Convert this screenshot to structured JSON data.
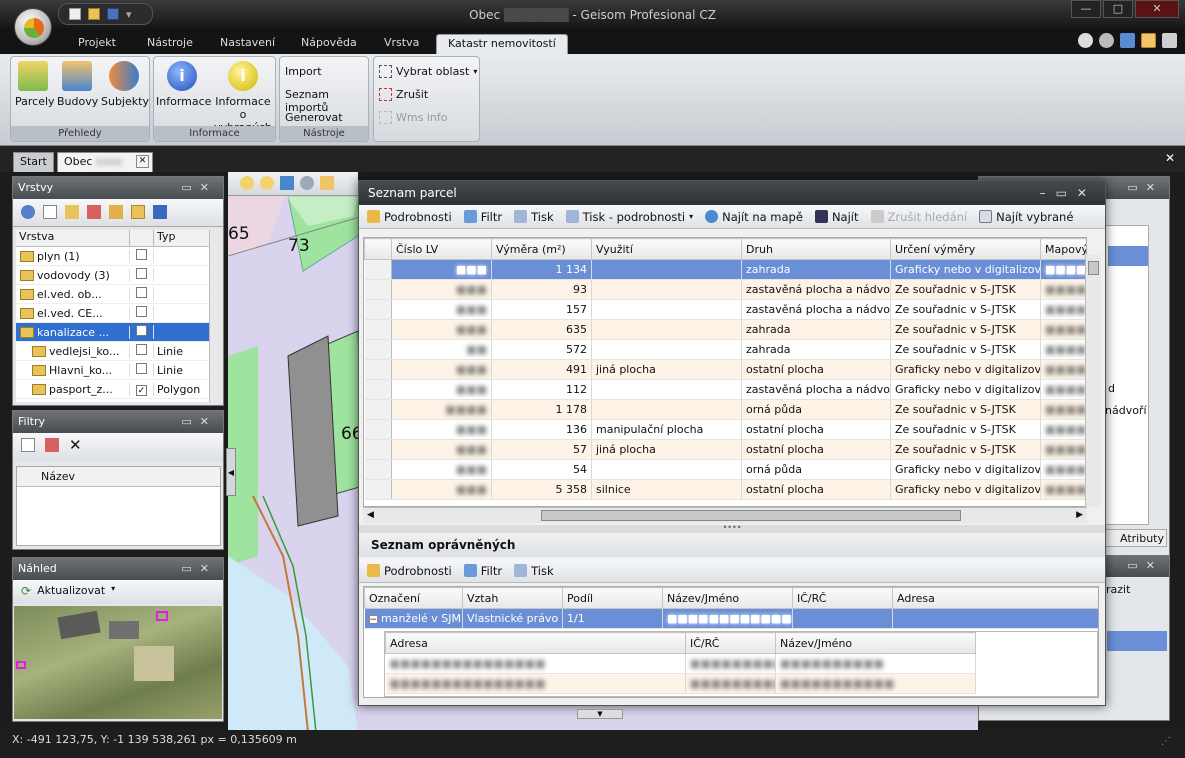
{
  "window": {
    "title": "Obec ■■■■ - Geisom Profesional CZ",
    "title_prefix": "Obec",
    "title_suffix": "- Geisom Profesional CZ"
  },
  "ribbon_tabs": [
    "Projekt",
    "Nástroje",
    "Nastavení",
    "Nápověda",
    "Vrstva",
    "Katastr nemovitostí"
  ],
  "ribbon": {
    "prehledy": {
      "label": "Přehledy",
      "buttons": [
        "Parcely",
        "Budovy",
        "Subjekty"
      ]
    },
    "informace": {
      "label": "Informace",
      "buttons": [
        "Informace",
        "Informace o vybraných"
      ]
    },
    "nastroje": {
      "label": "Nástroje",
      "buttons": [
        "Import",
        "Seznam importů",
        "Generovat mapu"
      ]
    },
    "vyber": {
      "buttons": [
        "Vybrat oblast",
        "Zrušit",
        "Wms info"
      ]
    }
  },
  "doc_tabs": [
    "Start",
    "Obec"
  ],
  "vrstvy": {
    "title": "Vrstvy",
    "columns": [
      "Vrstva",
      "Typ"
    ],
    "rows": [
      {
        "name": "plyn (1)",
        "type": ""
      },
      {
        "name": "vodovody (3)",
        "type": ""
      },
      {
        "name": "el.ved. ob...",
        "type": ""
      },
      {
        "name": "el.ved. CE...",
        "type": ""
      },
      {
        "name": "kanalizace ...",
        "type": ""
      },
      {
        "name": "vedlejsi_ko...",
        "type": "Linie"
      },
      {
        "name": "Hlavni_ko...",
        "type": "Linie"
      },
      {
        "name": "pasport_z...",
        "type": "Polygon"
      }
    ]
  },
  "filtry": {
    "title": "Filtry",
    "columns": [
      "Název"
    ]
  },
  "nahled": {
    "title": "Náhled",
    "refresh": "Aktualizovat"
  },
  "map": {
    "labels": [
      "65",
      "73",
      "66"
    ]
  },
  "status": {
    "coords": "X: -491 123,75, Y: -1 139 538,26",
    "scale": "1 px = 0,135609 m"
  },
  "seznam_parcel": {
    "title": "Seznam parcel",
    "toolbar": [
      "Podrobnosti",
      "Filtr",
      "Tisk",
      "Tisk - podrobnosti",
      "Najít na mapě",
      "Najít",
      "Zrušit hledání",
      "Najít vybrané"
    ],
    "columns": [
      "Číslo LV",
      "Výměra (m²)",
      "Využití",
      "Druh",
      "Určení výměry",
      "Mapový"
    ],
    "rows": [
      {
        "lv": "■■■",
        "vymera": "1 134",
        "vyuziti": "",
        "druh": "zahrada",
        "urceni": "Graficky nebo v digitalizova...",
        "map": "■■■■■■■"
      },
      {
        "lv": "■■■",
        "vymera": "93",
        "vyuziti": "",
        "druh": "zastavěná plocha a nádvoří",
        "urceni": "Ze souřadnic v S-JTSK",
        "map": "■■■■"
      },
      {
        "lv": "■■■",
        "vymera": "157",
        "vyuziti": "",
        "druh": "zastavěná plocha a nádvoří",
        "urceni": "Ze souřadnic v S-JTSK",
        "map": "■■■■"
      },
      {
        "lv": "■■■",
        "vymera": "635",
        "vyuziti": "",
        "druh": "zahrada",
        "urceni": "Ze souřadnic v S-JTSK",
        "map": "■■■■"
      },
      {
        "lv": "■■",
        "vymera": "572",
        "vyuziti": "",
        "druh": "zahrada",
        "urceni": "Ze souřadnic v S-JTSK",
        "map": "■■■■"
      },
      {
        "lv": "■■■",
        "vymera": "491",
        "vyuziti": "jiná plocha",
        "druh": "ostatní plocha",
        "urceni": "Graficky nebo v digitalizova...",
        "map": "■■■■"
      },
      {
        "lv": "■■■",
        "vymera": "112",
        "vyuziti": "",
        "druh": "zastavěná plocha a nádvoří",
        "urceni": "Graficky nebo v digitalizova...",
        "map": "■■■■"
      },
      {
        "lv": "■■■■",
        "vymera": "1 178",
        "vyuziti": "",
        "druh": "orná půda",
        "urceni": "Ze souřadnic v S-JTSK",
        "map": "■■■■"
      },
      {
        "lv": "■■■",
        "vymera": "136",
        "vyuziti": "manipulační plocha",
        "druh": "ostatní plocha",
        "urceni": "Ze souřadnic v S-JTSK",
        "map": "■■■■"
      },
      {
        "lv": "■■■",
        "vymera": "57",
        "vyuziti": "jiná plocha",
        "druh": "ostatní plocha",
        "urceni": "Ze souřadnic v S-JTSK",
        "map": "■■■■"
      },
      {
        "lv": "■■■",
        "vymera": "54",
        "vyuziti": "",
        "druh": "orná půda",
        "urceni": "Graficky nebo v digitalizova...",
        "map": "■■■■"
      },
      {
        "lv": "■■■",
        "vymera": "5 358",
        "vyuziti": "silnice",
        "druh": "ostatní plocha",
        "urceni": "Graficky nebo v digitalizova...",
        "map": "■■■■■■"
      }
    ]
  },
  "opravneni": {
    "title": "Seznam oprávněných",
    "toolbar": [
      "Podrobnosti",
      "Filtr",
      "Tisk"
    ],
    "columns": [
      "Označení",
      "Vztah",
      "Podíl",
      "Název/Jméno",
      "IČ/RČ",
      "Adresa"
    ],
    "row": {
      "oznaceni": "manželé v SJM",
      "vztah": "Vlastnické právo",
      "podil": "1/1",
      "nazev": "■■■■■■■■■■■■",
      "ic": "",
      "adresa": ""
    },
    "sub_columns": [
      "Adresa",
      "IČ/RČ",
      "Název/Jméno"
    ],
    "sub_rows": [
      {
        "adresa": "■■■■■■■■■■■■■■■",
        "ic": "■■■■■■■■■■",
        "nazev": "■■■■■■■■■■"
      },
      {
        "adresa": "■■■■■■■■■■■■■■■",
        "ic": "■■■■■■■■■■",
        "nazev": "■■■■■■■■■■■"
      }
    ]
  },
  "right_panel": {
    "labels": [
      "d",
      "nádvoří",
      "Atributy",
      "brazit"
    ]
  }
}
